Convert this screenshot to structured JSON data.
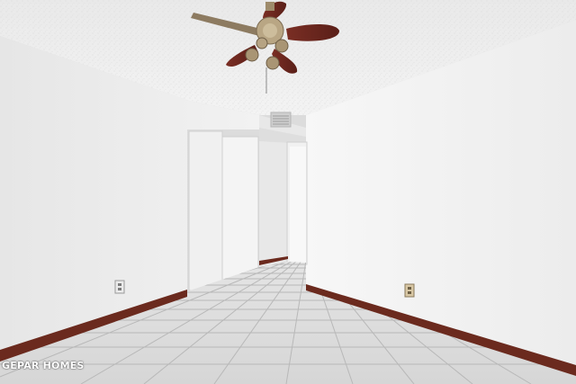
{
  "watermark": {
    "text": "GEPAR HOMES"
  }
}
